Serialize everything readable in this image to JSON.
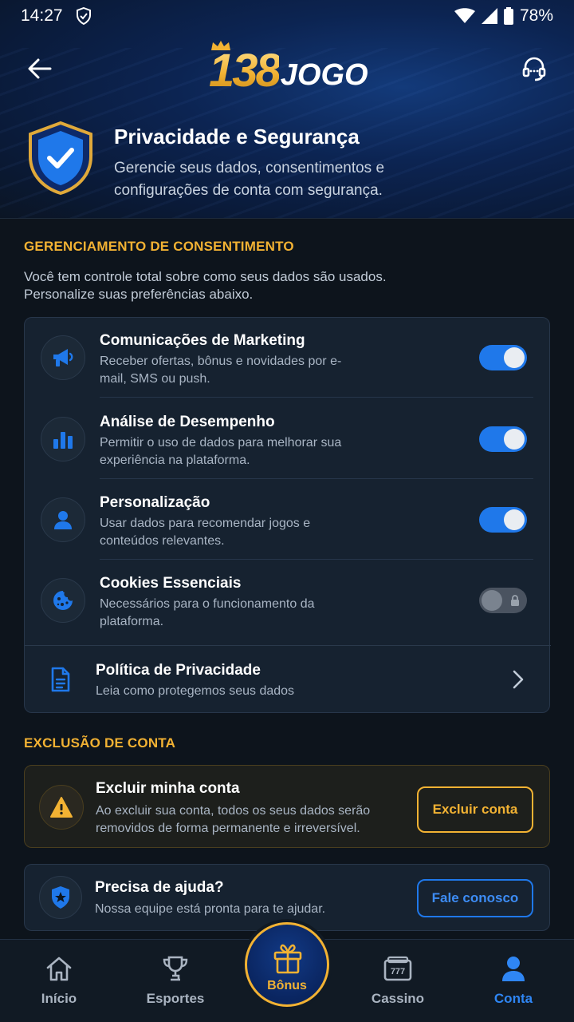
{
  "status_bar": {
    "time": "14:27",
    "battery": "78%"
  },
  "header": {
    "logo_number": "138",
    "logo_word": "JOGO"
  },
  "hero": {
    "title": "Privacidade e Segurança",
    "subtitle": "Gerencie seus dados, consentimentos e configurações de conta com segurança."
  },
  "consent": {
    "section_title": "GERENCIAMENTO DE CONSENTIMENTO",
    "description": "Você tem controle total sobre como seus dados são usados. Personalize suas preferências abaixo.",
    "items": [
      {
        "title": "Comunicações de Marketing",
        "desc": "Receber ofertas, bônus e novidades por e-mail, SMS ou push.",
        "enabled": true,
        "icon": "megaphone-icon"
      },
      {
        "title": "Análise de Desempenho",
        "desc": "Permitir o uso de dados para melhorar sua experiência na plataforma.",
        "enabled": true,
        "icon": "bar-chart-icon"
      },
      {
        "title": "Personalização",
        "desc": "Usar dados para recomendar jogos e conteúdos relevantes.",
        "enabled": true,
        "icon": "user-icon"
      },
      {
        "title": "Cookies Essenciais",
        "desc": "Necessários para o funcionamento da plataforma.",
        "enabled": false,
        "locked": true,
        "icon": "cookie-icon"
      }
    ],
    "policy": {
      "title": "Política de Privacidade",
      "desc": "Leia como protegemos seus dados"
    }
  },
  "deletion": {
    "section_title": "EXCLUSÃO DE CONTA",
    "title": "Excluir minha conta",
    "desc": "Ao excluir sua conta, todos os seus dados serão removidos de forma permanente e irreversível.",
    "button": "Excluir conta"
  },
  "help": {
    "title": "Precisa de ajuda?",
    "desc": "Nossa equipe está pronta para te ajudar.",
    "button": "Fale conosco"
  },
  "nav": {
    "items": [
      {
        "label": "Início"
      },
      {
        "label": "Esportes"
      },
      {
        "label": "Bônus"
      },
      {
        "label": "Cassino"
      },
      {
        "label": "Conta"
      }
    ],
    "active": "Conta"
  },
  "colors": {
    "accent_blue": "#1f78ea",
    "accent_gold": "#f2b233",
    "background": "#0d141c"
  }
}
